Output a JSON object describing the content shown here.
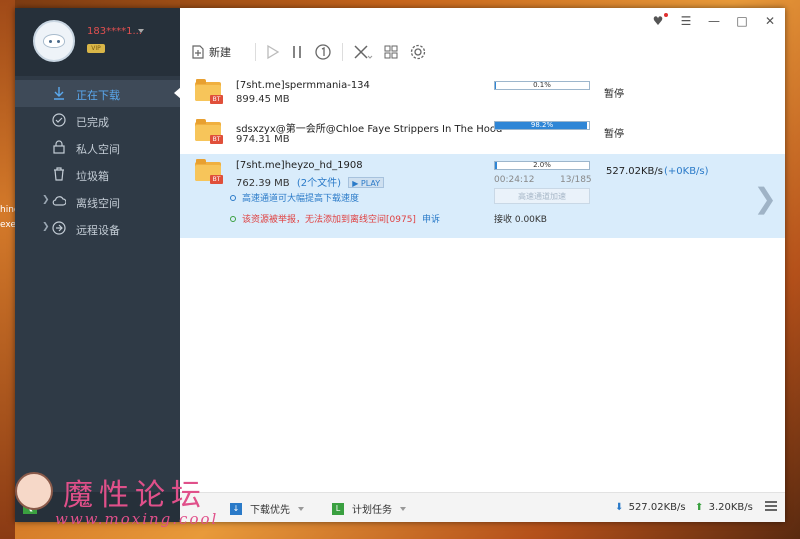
{
  "desktop": {
    "fragments": [
      "hinc",
      "exe"
    ]
  },
  "user": {
    "name": "183****1...",
    "vip": "VIP"
  },
  "sidebar": {
    "items": [
      {
        "label": "正在下载",
        "icon": "download-arrow-icon",
        "active": true
      },
      {
        "label": "已完成",
        "icon": "check-circle-icon",
        "active": false
      },
      {
        "label": "私人空间",
        "icon": "lock-icon",
        "active": false
      },
      {
        "label": "垃圾箱",
        "icon": "trash-icon",
        "active": false
      },
      {
        "label": "离线空间",
        "icon": "cloud-icon",
        "active": false,
        "expandable": true
      },
      {
        "label": "远程设备",
        "icon": "remote-device-icon",
        "active": false,
        "expandable": true
      }
    ]
  },
  "toolbar": {
    "new_label": "新建"
  },
  "downloads": [
    {
      "name": "[7sht.me]spermmania-134",
      "size": "899.45 MB",
      "progress_text": "0.1%",
      "progress": 0.001,
      "status": "暂停"
    },
    {
      "name": "sdsxzyx@第一会所@Chloe Faye Strippers In The Hood",
      "size": "974.31 MB",
      "progress_text": "98.2%",
      "progress": 0.982,
      "status": "暂停"
    },
    {
      "name": "[7sht.me]heyzo_hd_1908",
      "size": "762.39 MB",
      "files": "(2个文件)",
      "play": "PLAY",
      "progress_text": "2.0%",
      "progress": 0.02,
      "speed": "527.02KB/s",
      "speed_extra": "(+0KB/s)",
      "elapsed": "00:24:12",
      "pieces": "13/185",
      "accel_button": "高速通道加速",
      "tip_fast": "高速通道可大幅提高下载速度",
      "tip_reported": "该资源被举报，无法添加到离线空间[0975]",
      "appeal": "申诉",
      "received": "接收 0.00KB"
    }
  ],
  "bottombar": {
    "priority_label": "下载优先",
    "schedule_label": "计划任务",
    "down_speed": "527.02KB/s",
    "up_speed": "3.20KB/s"
  },
  "watermark": {
    "title": "魔性论坛",
    "url": "www.moxing.cool"
  },
  "colors": {
    "sidebar_bg": "#2f3a46",
    "accent": "#2f86d6",
    "selected_row": "#d9ecfb",
    "warning": "#e04040"
  }
}
